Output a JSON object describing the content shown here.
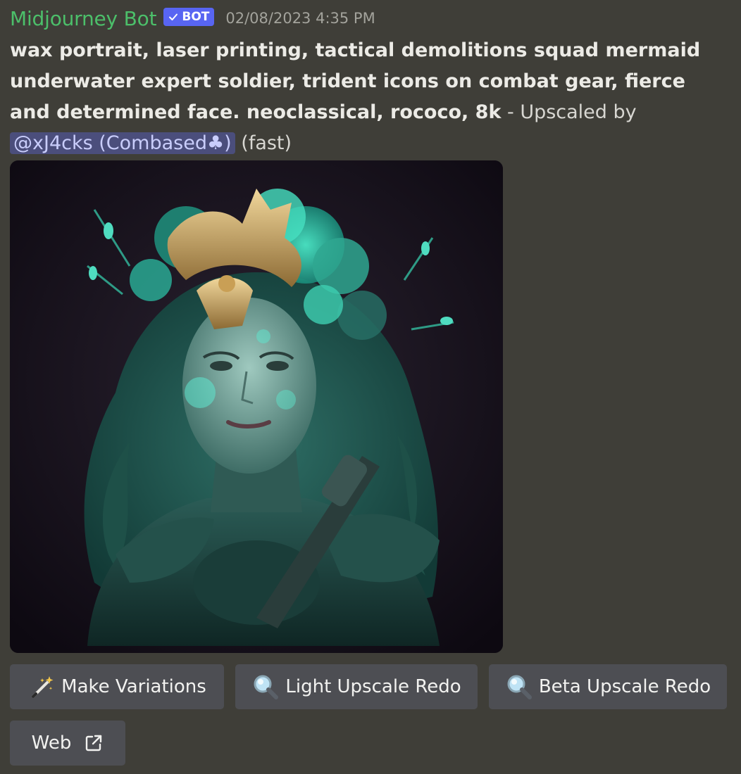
{
  "message": {
    "author": "Midjourney Bot",
    "badge_label": "BOT",
    "timestamp": "02/08/2023 4:35 PM",
    "prompt_text": "wax portrait, laser printing, tactical demolitions squad mermaid underwater expert soldier, trident icons on combat gear, fierce and determined face. neoclassical, rococo, 8k",
    "suffix_text": " - Upscaled by ",
    "mention": "@xJ4cks (Combased♣)",
    "speed": " (fast)",
    "image_icon": "generated-portrait-image"
  },
  "colors": {
    "background": "#3f3e38",
    "author": "#4cbf6a",
    "badge": "#5865f2",
    "mention_bg": "#4b4e7c",
    "mention_text": "#c9cdfb",
    "button": "#4d4e53"
  },
  "buttons": {
    "make_variations": {
      "label": "Make Variations",
      "icon": "magic-wand-icon"
    },
    "light_upscale_redo": {
      "label": "Light Upscale Redo",
      "icon": "magnifier-icon"
    },
    "beta_upscale_redo": {
      "label": "Beta Upscale Redo",
      "icon": "magnifier-icon"
    },
    "web": {
      "label": "Web",
      "icon": "external-link-icon"
    }
  }
}
